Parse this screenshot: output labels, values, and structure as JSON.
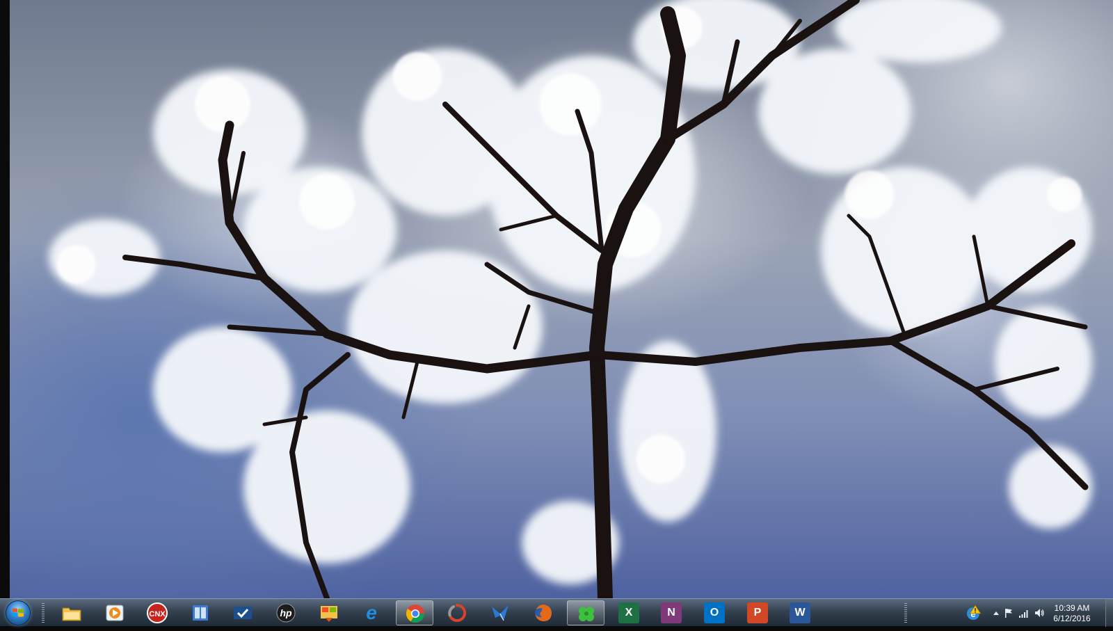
{
  "taskbar": {
    "start_label": "Start",
    "pinned": [
      {
        "name": "Windows Explorer",
        "icon": "folder-icon",
        "color": "#f3c14b"
      },
      {
        "name": "Windows Media Player",
        "icon": "media-player-icon",
        "color": "#f28a1d"
      },
      {
        "name": "CNX",
        "icon": "cnx-icon",
        "label": "CNX",
        "color": "#c6241d"
      },
      {
        "name": "Book",
        "icon": "book-icon",
        "color": "#3a7bd5"
      },
      {
        "name": "Tasks",
        "icon": "checkmark-icon",
        "color": "#1f4e8c"
      },
      {
        "name": "HP",
        "icon": "hp-icon",
        "label": "hp",
        "color": "#0a67b0"
      },
      {
        "name": "Windows Update",
        "icon": "update-icon",
        "color": "#d95a1c"
      },
      {
        "name": "Internet Explorer",
        "icon": "internet-explorer-icon",
        "label": "e",
        "color": "#1f8fe0"
      },
      {
        "name": "Google Chrome",
        "icon": "chrome-icon",
        "color": "#db4437",
        "active": true
      },
      {
        "name": "Loading",
        "icon": "spinner-icon",
        "color": "#d7432b"
      },
      {
        "name": "Mail",
        "icon": "bird-icon",
        "color": "#2b79d3"
      },
      {
        "name": "Firefox",
        "icon": "firefox-icon",
        "color": "#e46a1b"
      },
      {
        "name": "Clover",
        "icon": "clover-icon",
        "color": "#3fbf3f",
        "active": true
      },
      {
        "name": "Excel",
        "icon": "excel-icon",
        "label": "X",
        "color": "#1e7145"
      },
      {
        "name": "OneNote",
        "icon": "onenote-icon",
        "label": "N",
        "color": "#80397b"
      },
      {
        "name": "Outlook",
        "icon": "outlook-icon",
        "label": "O",
        "color": "#0072c6"
      },
      {
        "name": "PowerPoint",
        "icon": "powerpoint-icon",
        "label": "P",
        "color": "#d24726"
      },
      {
        "name": "Word",
        "icon": "word-icon",
        "label": "W",
        "color": "#2b579a"
      }
    ]
  },
  "tray": {
    "time": "10:39 AM",
    "date": "6/12/2016"
  },
  "colors": {
    "taskbar_top": "#5b6b80",
    "taskbar_bottom": "#1f2a36",
    "accent": "#2e7bc7"
  }
}
